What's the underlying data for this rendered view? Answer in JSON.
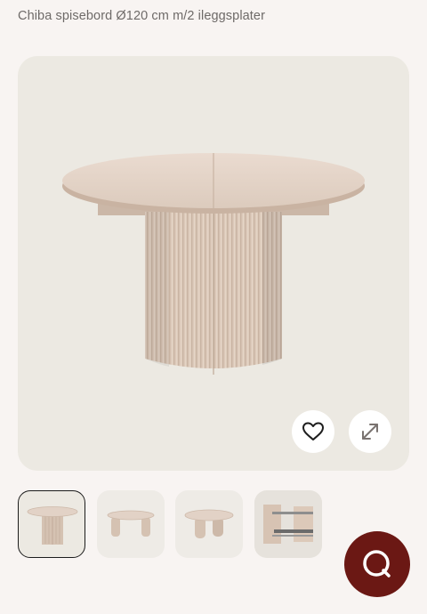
{
  "product": {
    "title": "Chiba spisebord Ø120 cm m/2 ileggsplater"
  },
  "gallery": {
    "main_image": "Round extendable dining table with fluted pedestal base",
    "thumbnails": [
      {
        "name": "thumbnail-1",
        "active": true
      },
      {
        "name": "thumbnail-2",
        "active": false
      },
      {
        "name": "thumbnail-3",
        "active": false
      },
      {
        "name": "thumbnail-4",
        "active": false
      }
    ],
    "actions": {
      "favorite_icon": "heart-icon",
      "expand_icon": "expand-arrows-icon"
    }
  },
  "chat": {
    "icon": "chat-bubble-icon"
  },
  "colors": {
    "background": "#f8f4f2",
    "image_bg": "#ece9e2",
    "chat_button": "#6b1814",
    "title_text": "#6e6a68"
  }
}
